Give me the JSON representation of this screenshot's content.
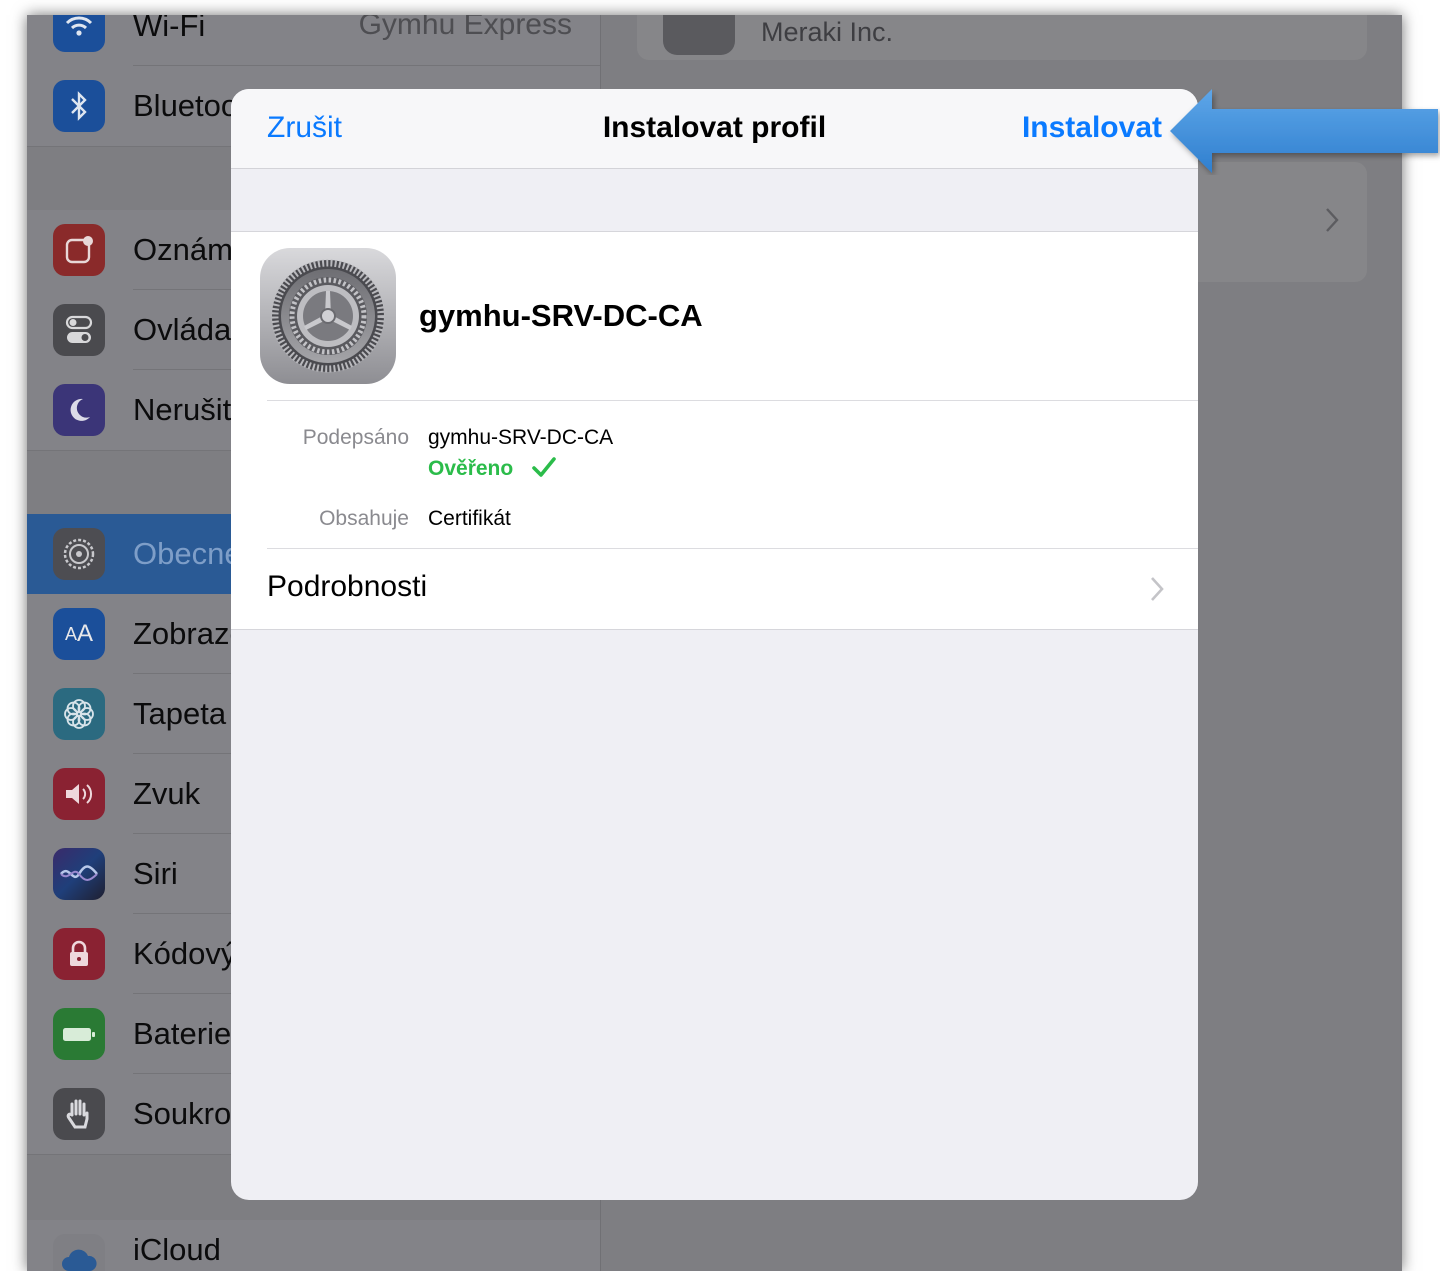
{
  "sidebar": {
    "wifi": {
      "label": "Wi-Fi",
      "value": "Gymhu Express"
    },
    "bluetooth": {
      "label": "Bluetooth"
    },
    "notifications": {
      "label": "Oznámení"
    },
    "control_center": {
      "label": "Ovládací centrum"
    },
    "do_not_disturb": {
      "label": "Nerušit"
    },
    "general": {
      "label": "Obecné"
    },
    "display": {
      "label": "Zobrazení a jas"
    },
    "wallpaper": {
      "label": "Tapeta"
    },
    "sound": {
      "label": "Zvuk"
    },
    "siri": {
      "label": "Siri"
    },
    "passcode": {
      "label": "Kódový zámek"
    },
    "battery": {
      "label": "Baterie"
    },
    "privacy": {
      "label": "Soukromí"
    },
    "icloud": {
      "label": "iCloud"
    }
  },
  "right_panel": {
    "org_label": "Meraki Inc."
  },
  "modal": {
    "cancel_label": "Zrušit",
    "title": "Instalovat profil",
    "install_label": "Instalovat",
    "profile_name": "gymhu-SRV-DC-CA",
    "signed_label": "Podepsáno",
    "signed_value": "gymhu-SRV-DC-CA",
    "verified_label": "Ověřeno",
    "contains_label": "Obsahuje",
    "contains_value": "Certifikát",
    "details_label": "Podrobnosti"
  },
  "colors": {
    "accent": "#0a7aff",
    "verified": "#2bbc4a",
    "arrow": "#3d8fd9"
  }
}
